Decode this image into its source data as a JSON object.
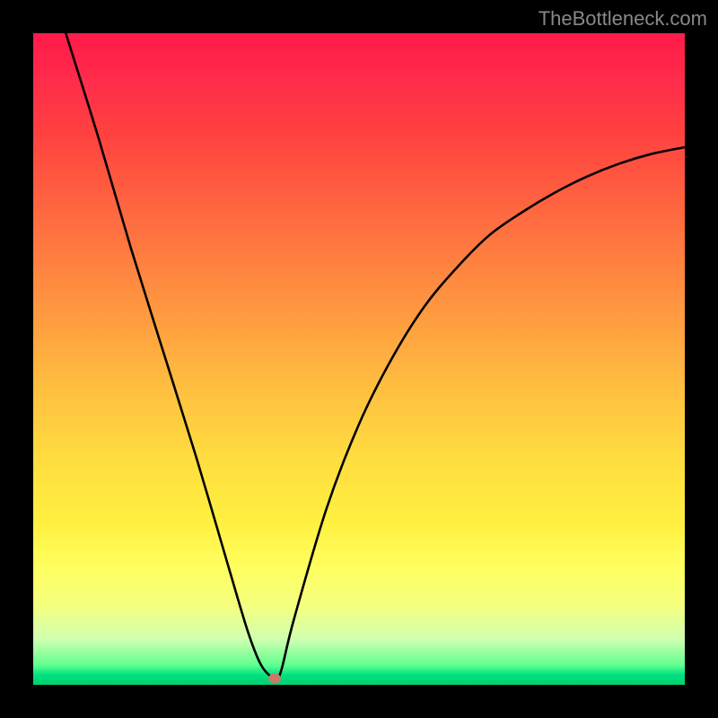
{
  "attribution": "TheBottleneck.com",
  "chart_data": {
    "type": "line",
    "title": "",
    "xlabel": "",
    "ylabel": "",
    "xlim": [
      0,
      100
    ],
    "ylim": [
      0,
      100
    ],
    "series": [
      {
        "name": "bottleneck-curve",
        "x": [
          5,
          10,
          15,
          20,
          25,
          30,
          33,
          35,
          37,
          38,
          40,
          45,
          50,
          55,
          60,
          65,
          70,
          75,
          80,
          85,
          90,
          95,
          100
        ],
        "values": [
          100,
          84,
          67,
          51,
          35,
          18,
          8,
          3,
          1,
          2,
          10,
          27,
          40,
          50,
          58,
          64,
          69,
          72.5,
          75.5,
          78,
          80,
          81.5,
          82.5
        ]
      }
    ],
    "marker": {
      "x": 37,
      "y": 1
    },
    "background": "rainbow-vertical",
    "colors": {
      "curve": "#000000",
      "marker": "#c97a6a",
      "frame": "#000000"
    }
  }
}
